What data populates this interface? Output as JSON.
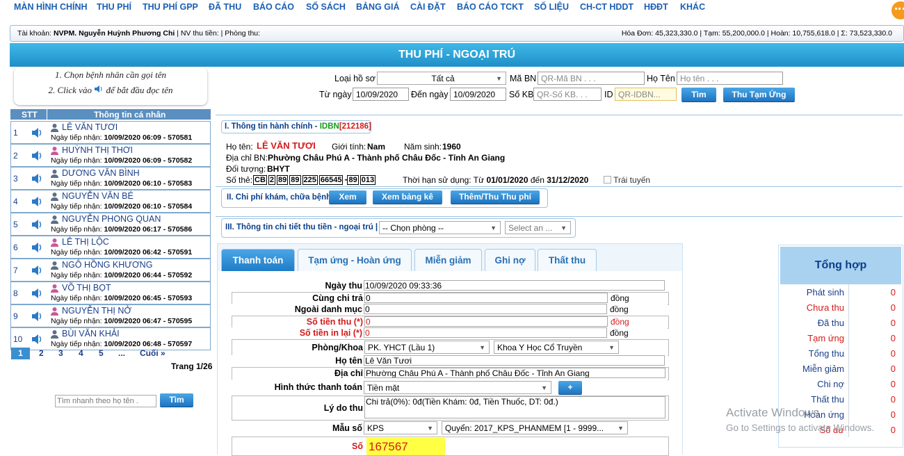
{
  "menu": [
    "MÀN HÌNH CHÍNH",
    "THU PHÍ",
    "THU PHÍ GPP",
    "ĐÃ THU",
    "BÁO CÁO",
    "SỔ SÁCH",
    "BẢNG GIÁ",
    "CÀI ĐẶT",
    "BÁO CÁO TCKT",
    "SỐ LIỆU",
    "CH-CT HDDT",
    "HĐĐT",
    "KHÁC"
  ],
  "account": {
    "left_label": "Tài khoản:",
    "user": "NVPM. Nguyễn Huỳnh Phương Chi",
    "rest": "| NV thu tiền: | Phòng thu:",
    "right": "Hóa Đơn: 45,323,330.0 | Tạm: 55,200,000.0 | Hoàn: 10,755,618.0 | Σ: 73,523,330.0"
  },
  "title": "THU PHÍ - NGOẠI TRÚ",
  "instructions": {
    "line1": "1. Chọn bệnh nhân cần gọi tên",
    "line2a": "2. Click vào",
    "line2b": "để bắt đầu đọc tên"
  },
  "list": {
    "col_stt": "STT",
    "col_info": "Thông tin cá nhân",
    "date_label": "Ngày tiếp nhận:",
    "patients": [
      {
        "num": "1",
        "name": "LÊ VĂN TƯƠI",
        "date": "10/09/2020 06:09 - 570581",
        "gender": "m"
      },
      {
        "num": "2",
        "name": "HUỲNH THỊ THƠI",
        "date": "10/09/2020 06:09 - 570582",
        "gender": "f"
      },
      {
        "num": "3",
        "name": "DƯƠNG VĂN BÌNH",
        "date": "10/09/2020 06:10 - 570583",
        "gender": "m"
      },
      {
        "num": "4",
        "name": "NGUYỄN VĂN BÉ",
        "date": "10/09/2020 06:10 - 570584",
        "gender": "m"
      },
      {
        "num": "5",
        "name": "NGUYỄN PHONG QUAN",
        "date": "10/09/2020 06:17 - 570586",
        "gender": "m"
      },
      {
        "num": "6",
        "name": "LÊ THỊ LỘC",
        "date": "10/09/2020 06:42 - 570591",
        "gender": "f"
      },
      {
        "num": "7",
        "name": "NGÔ HỒNG KHƯƠNG",
        "date": "10/09/2020 06:44 - 570592",
        "gender": "m"
      },
      {
        "num": "8",
        "name": "VÕ THỊ BỌT",
        "date": "10/09/2020 06:45 - 570593",
        "gender": "f"
      },
      {
        "num": "9",
        "name": "NGUYỄN THỊ NỞ",
        "date": "10/09/2020 06:47 - 570595",
        "gender": "f"
      },
      {
        "num": "10",
        "name": "BÙI VĂN KHẢI",
        "date": "10/09/2020 06:48 - 570597",
        "gender": "m"
      }
    ],
    "pages": [
      "1",
      "2",
      "3",
      "4",
      "5",
      "...",
      "Cuối »"
    ],
    "page_info": "Trang 1/26",
    "quick_search_placeholder": "Tìm nhanh theo họ tên .",
    "search_button": "Tìm"
  },
  "search": {
    "loai_ho_so_label": "Loại hồ sơ",
    "loai_ho_so_value": "Tất cả",
    "ma_bn_label": "Mã BN",
    "ma_bn_placeholder": "QR-Mã BN . . .",
    "ho_ten_label": "Họ Tên",
    "ho_ten_placeholder": "Họ tên . . .",
    "tu_ngay_label": "Từ ngày",
    "tu_ngay_value": "10/09/2020",
    "den_ngay_label": "Đến ngày",
    "den_ngay_value": "10/09/2020",
    "so_kb_label": "Số KB",
    "so_kb_placeholder": "QR-Số KB. . .",
    "id_label": "ID",
    "id_placeholder": "QR-IDBN...",
    "find_button": "Tìm",
    "advance_button": "Thu Tạm Ứng"
  },
  "section1": {
    "title": "I. Thông tin hành chính - ",
    "idbn_label": "IDBN",
    "idbn_value": "[212186]",
    "ho_ten_label": "Họ tên:",
    "ho_ten": "LÊ VĂN TƯƠI",
    "gioi_tinh_label": "Giới tính:",
    "gioi_tinh": "Nam",
    "nam_sinh_label": "Năm sinh:",
    "nam_sinh": "1960",
    "dia_chi_label": "Địa chỉ BN:",
    "dia_chi": "Phường Châu Phú A - Thành phố Châu Đốc - Tỉnh An Giang",
    "doi_tuong_label": "Đối tượng:",
    "doi_tuong": "BHYT",
    "so_the_label": "Số thẻ:",
    "so_the": [
      "CB",
      "2",
      "89",
      "89",
      "225",
      "66545",
      "89",
      "013"
    ],
    "thoi_han_label": "Thời hạn sử dụng: Từ",
    "tu": "01/01/2020",
    "den_label": "đến",
    "den": "31/12/2020",
    "trai_tuyen": "Trái tuyến"
  },
  "section2": {
    "title": "II. Chi phí khám, chữa bệnh",
    "btn_view": "Xem",
    "btn_list": "Xem bảng kê",
    "btn_add": "Thêm/Thu Thu phí"
  },
  "section3": {
    "title": "III. Thông tin chi tiết thu tiền - ngoại trú |",
    "room_select": "-- Chọn phòng --",
    "select_an": "Select an ..."
  },
  "tabs": [
    "Thanh toán",
    "Tạm ứng - Hoàn ứng",
    "Miễn giảm",
    "Ghi nợ",
    "Thất thu"
  ],
  "form": {
    "ngay_thu_label": "Ngày thu",
    "ngay_thu": "10/09/2020 09:33:36",
    "cung_chi_tra_label": "Cùng chi trả",
    "cung_chi_tra": "0",
    "ngoai_danh_muc_label": "Ngoài danh mục",
    "ngoai_danh_muc": "0",
    "so_tien_thu_label": "Số tiền thu (*)",
    "so_tien_thu": "0",
    "so_tien_in_lai_label": "Số tiền in lại (*)",
    "so_tien_in_lai": "0",
    "unit": "đồng",
    "phong_khoa_label": "Phòng/Khoa",
    "phong": "PK. YHCT (Lầu 1)",
    "khoa": "Khoa Y Học Cổ Truyền",
    "ho_ten_label": "Họ tên",
    "ho_ten": "Lê Văn Tươi",
    "dia_chi_label": "Địa chỉ",
    "dia_chi": "Phường Châu Phú A - Thành phố Châu Đốc - Tỉnh An Giang",
    "hinh_thuc_label": "Hình thức thanh toán",
    "hinh_thuc": "Tiền mặt",
    "plus": "+",
    "ly_do_label": "Lý do thu",
    "ly_do": "Chi trả(0%): 0đ(Tiền Khám: 0đ, Tiền Thuốc, DT: 0đ.)",
    "mau_so_label": "Mẫu số",
    "mau_so": "KPS",
    "quyen": "Quyển: 2017_KPS_PHANMEM [1 - 9999...",
    "so_label": "Số",
    "so": "167567"
  },
  "summary": {
    "title": "Tổng hợp",
    "rows": [
      {
        "label": "Phát sinh",
        "value": "0",
        "color": "#1a3f8a"
      },
      {
        "label": "Chưa thu",
        "value": "0",
        "color": "#d41a1a"
      },
      {
        "label": "Đã thu",
        "value": "0",
        "color": "#1a3f8a"
      },
      {
        "label": "Tạm ứng",
        "value": "0",
        "color": "#d41a1a"
      },
      {
        "label": "Tổng thu",
        "value": "0",
        "color": "#1a3f8a"
      },
      {
        "label": "Miễn giảm",
        "value": "0",
        "color": "#1a3f8a"
      },
      {
        "label": "Chi nợ",
        "value": "0",
        "color": "#1a3f8a"
      },
      {
        "label": "Thất thu",
        "value": "0",
        "color": "#1a3f8a"
      },
      {
        "label": "Hoàn ứng",
        "value": "0",
        "color": "#1a3f8a"
      },
      {
        "label": "Số dư",
        "value": "0",
        "color": "#d41a1a"
      }
    ]
  },
  "watermark": {
    "line1": "Activate Windows",
    "line2": "Go to Settings to activate Windows."
  },
  "colors": {
    "accent": "#1f8fc7",
    "link": "#1a5fb4",
    "danger": "#d41a1a"
  }
}
